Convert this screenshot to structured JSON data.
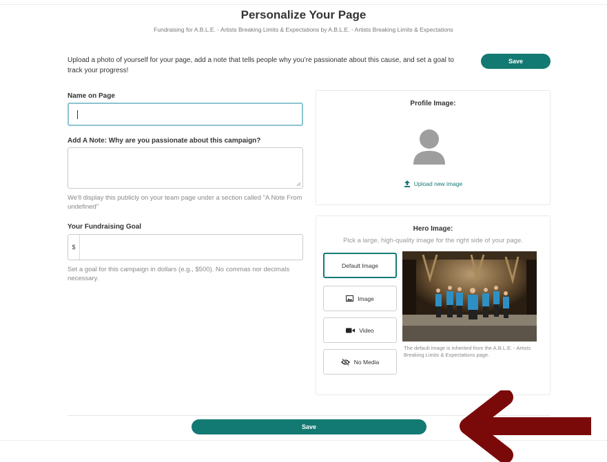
{
  "page": {
    "title": "Personalize Your Page",
    "subtitle": "Fundraising for A.B.L.E. - Artists Breaking Limits & Expectations by A.B.L.E. - Artists Breaking Limits & Expectations",
    "intro": "Upload a photo of yourself for your page, add a note that tells people why you’re passionate about this cause, and set a goal to track your progress!",
    "save_label": "Save"
  },
  "form": {
    "name_label": "Name on Page",
    "name_value": "",
    "note_label": "Add A Note: Why are you passionate about this campaign?",
    "note_value": "",
    "note_help": "We'll display this publicly on your team page under a section called \"A Note From undefined\"",
    "goal_label": "Your Fundraising Goal",
    "goal_prefix": "$",
    "goal_value": "",
    "goal_help": "Set a goal for this campaign in dollars (e.g., $500). No commas nor decimals necessary."
  },
  "profile": {
    "title": "Profile Image:",
    "upload_label": "Upload new image",
    "icons": {
      "avatar": "avatar-placeholder-icon",
      "upload": "upload-icon"
    }
  },
  "hero": {
    "title": "Hero Image:",
    "subtitle": "Pick a large, high-quality image for the right side of your page.",
    "options": [
      {
        "label": "Default Image",
        "icon": "",
        "selected": true
      },
      {
        "label": "Image",
        "icon": "image-icon",
        "selected": false
      },
      {
        "label": "Video",
        "icon": "video-camera-icon",
        "selected": false
      },
      {
        "label": "No Media",
        "icon": "eye-slash-icon",
        "selected": false
      }
    ],
    "caption": "The default image is inherited from the A.B.L.E. - Artists Breaking Limits & Expectations page."
  },
  "colors": {
    "accent": "#127a72",
    "arrow": "#7a0a0a",
    "focus_border": "#8cc3cf"
  }
}
